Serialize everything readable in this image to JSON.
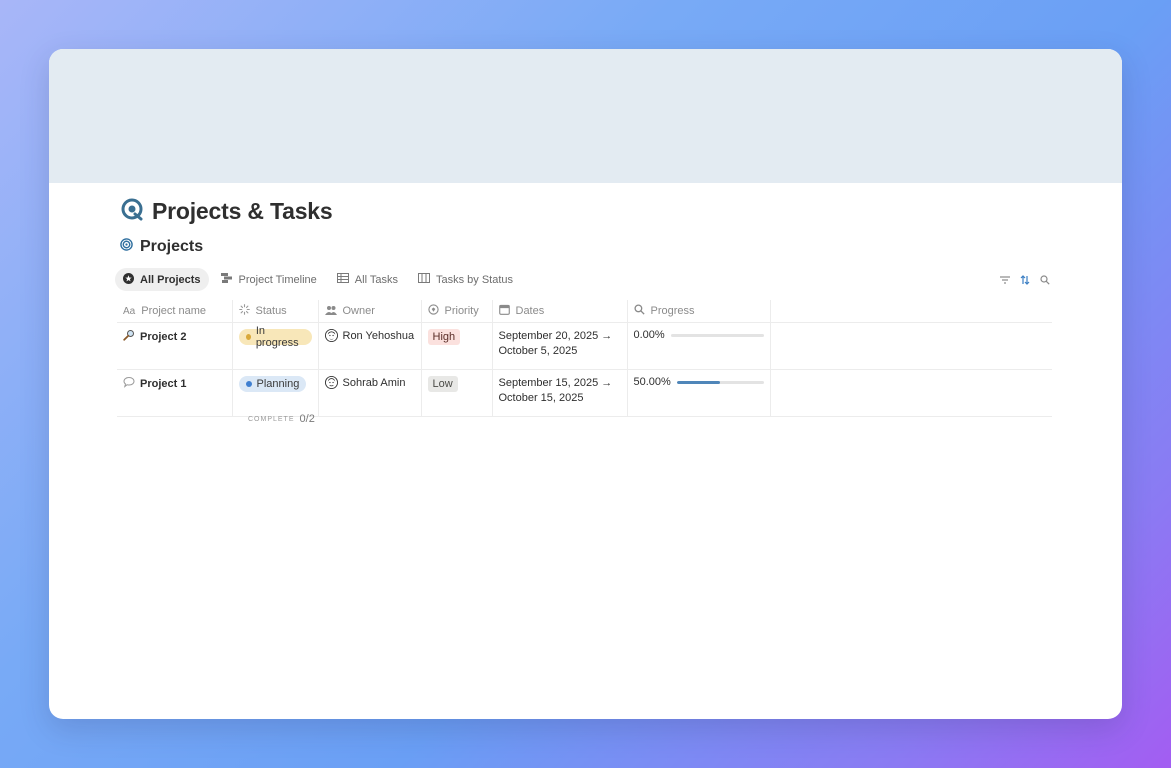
{
  "page": {
    "title": "Projects & Tasks",
    "icon": "target-refresh-icon"
  },
  "database": {
    "title": "Projects",
    "icon": "target-icon"
  },
  "views": [
    {
      "label": "All Projects",
      "icon": "star-circle-icon",
      "active": true
    },
    {
      "label": "Project Timeline",
      "icon": "timeline-icon",
      "active": false
    },
    {
      "label": "All Tasks",
      "icon": "table-icon",
      "active": false
    },
    {
      "label": "Tasks by Status",
      "icon": "board-icon",
      "active": false
    }
  ],
  "toolbar": {
    "filter_icon": "filter-icon",
    "sort_icon": "sort-icon",
    "search_icon": "search-icon"
  },
  "columns": [
    {
      "label": "Project name",
      "icon": "text-icon"
    },
    {
      "label": "Status",
      "icon": "status-icon"
    },
    {
      "label": "Owner",
      "icon": "people-icon"
    },
    {
      "label": "Priority",
      "icon": "priority-icon"
    },
    {
      "label": "Dates",
      "icon": "calendar-icon"
    },
    {
      "label": "Progress",
      "icon": "search-icon"
    }
  ],
  "rows": [
    {
      "name": "Project 2",
      "icon": "magnifier-icon",
      "status": "In progress",
      "status_bg": "#f8e7b9",
      "status_dot": "#d9a93a",
      "owner": "Ron Yehoshua",
      "priority": "High",
      "priority_bg": "#fbe1de",
      "date_start": "September 20, 2025 →",
      "date_end": "October 5, 2025",
      "progress_text": "0.00%",
      "progress": 0.0
    },
    {
      "name": "Project 1",
      "icon": "speech-bubble-icon",
      "status": "Planning",
      "status_bg": "#dbe8f6",
      "status_dot": "#3f7fd0",
      "owner": "Sohrab Amin",
      "priority": "Low",
      "priority_bg": "#e8e8e6",
      "date_start": "September 15, 2025 →",
      "date_end": "October 15, 2025",
      "progress_text": "50.00%",
      "progress": 0.5
    }
  ],
  "footer": {
    "calc_label": "COMPLETE",
    "calc_value": "0/2"
  }
}
